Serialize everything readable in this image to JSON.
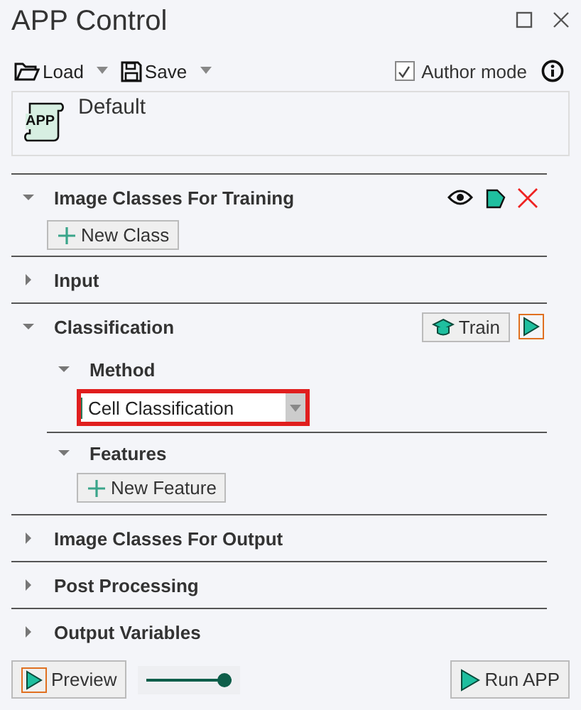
{
  "title": "APP Control",
  "toolbar": {
    "load": "Load",
    "save": "Save",
    "author_mode": {
      "label": "Author mode",
      "checked": true
    }
  },
  "preset": {
    "icon_text": "APP",
    "name": "Default"
  },
  "sections": [
    {
      "title": "Image Classes For Training",
      "expanded": true,
      "actions": [
        {
          "kind": "view"
        },
        {
          "kind": "shape"
        },
        {
          "kind": "delete"
        }
      ],
      "content": [
        {
          "kind": "button",
          "label": "New Class"
        }
      ]
    },
    {
      "title": "Input",
      "expanded": false
    },
    {
      "title": "Classification",
      "expanded": true,
      "actions": [
        {
          "kind": "train",
          "label": "Train"
        },
        {
          "kind": "run"
        }
      ],
      "content": [
        {
          "kind": "subsection",
          "title": "Method",
          "expanded": true,
          "content": [
            {
              "kind": "dropdown",
              "value": "Cell Classification",
              "highlighted": true
            }
          ]
        },
        {
          "kind": "subsection",
          "title": "Features",
          "expanded": true,
          "content": [
            {
              "kind": "button",
              "label": "New Feature"
            }
          ]
        }
      ]
    },
    {
      "title": "Image Classes For Output",
      "expanded": false
    },
    {
      "title": "Post Processing",
      "expanded": false
    },
    {
      "title": "Output Variables",
      "expanded": false
    }
  ],
  "footer": {
    "preview": "Preview",
    "slider": {
      "level": 1
    },
    "run": "Run APP"
  }
}
